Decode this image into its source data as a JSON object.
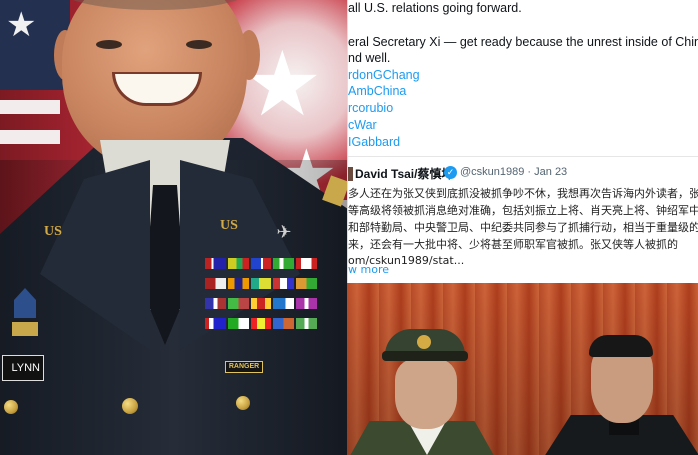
{
  "left_photo": {
    "nametag": "LYNN",
    "collar_pin_left": "US",
    "collar_pin_right": "US",
    "tab_label": "RANGER"
  },
  "tweet": {
    "lines": [
      "all U.S. relations going forward.",
      "",
      "eral Secretary Xi — get ready because the unrest inside of China",
      "nd well."
    ],
    "mentions": [
      "rdonGChang",
      "AmbChina",
      "rcorubio",
      "cWar",
      "IGabbard"
    ],
    "quoted": {
      "name": "David Tsai/蔡慎坤",
      "handle": "@cskun1989 · Jan 23",
      "text_lines": [
        "多人还在为张又侠到底抓没被抓争吵不休，我想再次告诉海内外读者，张又侠",
        "等高级将领被抓消息绝对准确，包括刘振立上将、肖天亮上将、钟绍军中将等",
        "和部特勤局、中央警卫局、中纪委共同参与了抓捕行动，相当于重量级的军变",
        "来，还会有一大批中将、少将甚至师职军官被抓。张又侠等人被抓的",
        "om/cskun1989/stat..."
      ],
      "show_more": "w more"
    }
  },
  "colors": {
    "link": "#1d9bf0",
    "uniform": "#1d2430",
    "background_red": "#c4303c"
  }
}
